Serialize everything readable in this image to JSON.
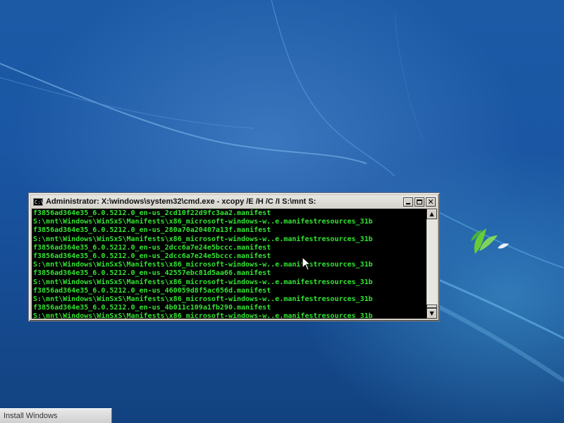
{
  "window": {
    "title": "Administrator: X:\\windows\\system32\\cmd.exe - xcopy  /E /H /C /I S:\\mnt S:",
    "icon": "cmd-icon",
    "controls": [
      "minimize",
      "maximize",
      "close"
    ]
  },
  "console": {
    "text_color": "#32e432",
    "lines": [
      "f3856ad364e35_6.0.5212.0_en-us_2cd10f22d9fc3aa2.manifest",
      "S:\\mnt\\Windows\\WinSxS\\Manifests\\x86_microsoft-windows-w..e.manifestresources_31b",
      "f3856ad364e35_6.0.5212.0_en-us_280a70a20407a13f.manifest",
      "S:\\mnt\\Windows\\WinSxS\\Manifests\\x86_microsoft-windows-w..e.manifestresources_31b",
      "f3856ad364e35_6.0.5212.0_en-us_2dcc6a7e24e5bccc.manifest",
      "f3856ad364e35_6.0.5212.0_en-us_2dcc6a7e24e5bccc.manifest",
      "S:\\mnt\\Windows\\WinSxS\\Manifests\\x86_microsoft-windows-w..e.manifestresources_31b",
      "f3856ad364e35_6.0.5212.0_en-us_42557ebc81d5aa66.manifest",
      "S:\\mnt\\Windows\\WinSxS\\Manifests\\x86_microsoft-windows-w..e.manifestresources_31b",
      "f3856ad364e35_6.0.5212.0_en-us_460059d8f5ac656d.manifest",
      "S:\\mnt\\Windows\\WinSxS\\Manifests\\x86_microsoft-windows-w..e.manifestresources_31b",
      "f3856ad364e35_6.0.5212.0_en-us_4b011c109a1fb290.manifest",
      "S:\\mnt\\Windows\\WinSxS\\Manifests\\x86_microsoft-windows-w..e.manifestresources_31b"
    ]
  },
  "taskbar": {
    "button_label": "Install Windows"
  },
  "colors": {
    "desktop_background": "#1a56a3",
    "console_background": "#000000",
    "window_frame": "#d4d0c8"
  }
}
